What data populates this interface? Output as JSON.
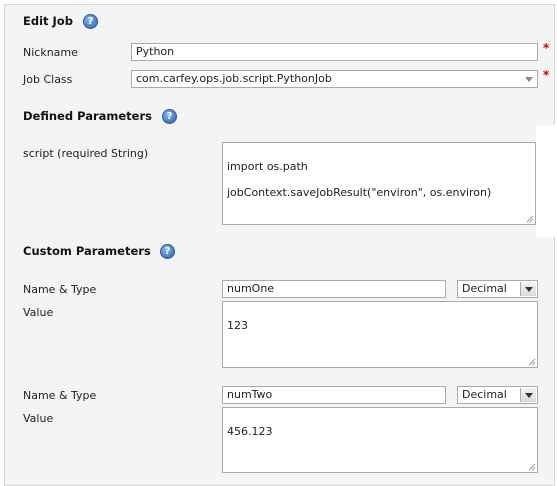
{
  "edit_job": {
    "title": "Edit Job",
    "help_icon": "help-icon",
    "nickname": {
      "label": "Nickname",
      "value": "Python",
      "required_mark": "*"
    },
    "job_class": {
      "label": "Job Class",
      "value": "com.carfey.ops.job.script.PythonJob",
      "required_mark": "*"
    }
  },
  "defined_parameters": {
    "title": "Defined Parameters",
    "script": {
      "label": "script (required String)",
      "value": "import os.path\n\njobContext.saveJobResult(\"environ\", os.environ)"
    }
  },
  "custom_parameters": {
    "title": "Custom Parameters",
    "params": [
      {
        "name_type_label": "Name & Type",
        "name": "numOne",
        "type": "Decimal",
        "value_label": "Value",
        "value": "123"
      },
      {
        "name_type_label": "Name & Type",
        "name": "numTwo",
        "type": "Decimal",
        "value_label": "Value",
        "value": "456.123"
      }
    ]
  }
}
